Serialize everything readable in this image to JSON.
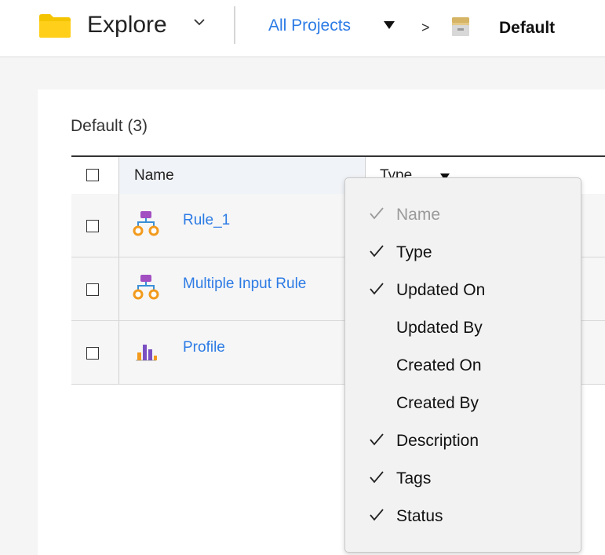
{
  "header": {
    "app_title": "Explore",
    "breadcrumb": {
      "root": "All Projects",
      "separator": ">",
      "current": "Default"
    }
  },
  "main": {
    "section_title": "Default (3)",
    "columns": {
      "name": "Name",
      "type": "Type"
    },
    "rows": [
      {
        "name": "Rule_1",
        "icon": "rule-tree-icon"
      },
      {
        "name": "Multiple Input Rule",
        "icon": "rule-tree-icon"
      },
      {
        "name": "Profile",
        "icon": "profile-chart-icon"
      }
    ]
  },
  "column_menu": {
    "items": [
      {
        "label": "Name",
        "checked": true,
        "disabled": true
      },
      {
        "label": "Type",
        "checked": true,
        "disabled": false
      },
      {
        "label": "Updated On",
        "checked": true,
        "disabled": false
      },
      {
        "label": "Updated By",
        "checked": false,
        "disabled": false
      },
      {
        "label": "Created On",
        "checked": false,
        "disabled": false
      },
      {
        "label": "Created By",
        "checked": false,
        "disabled": false
      },
      {
        "label": "Description",
        "checked": true,
        "disabled": false
      },
      {
        "label": "Tags",
        "checked": true,
        "disabled": false
      },
      {
        "label": "Status",
        "checked": true,
        "disabled": false
      }
    ]
  },
  "colors": {
    "link": "#2c7be5",
    "folder": "#f5c400",
    "rule_icon_purple": "#a24fc2",
    "rule_icon_orange": "#f29a1d"
  }
}
